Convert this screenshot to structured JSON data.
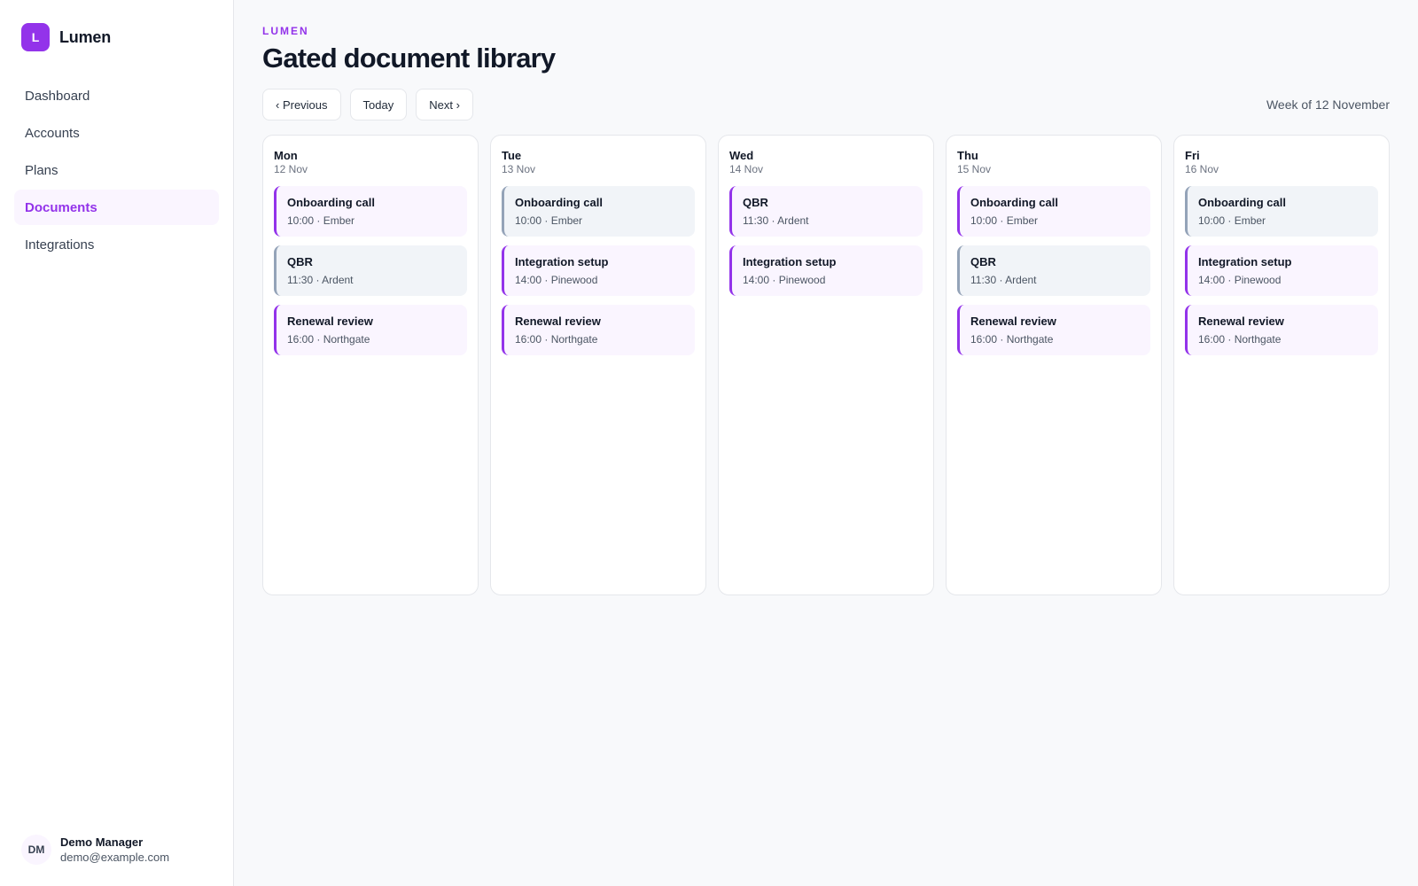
{
  "brand": {
    "logo_letter": "L",
    "name": "Lumen"
  },
  "nav": [
    {
      "label": "Dashboard",
      "active": false
    },
    {
      "label": "Accounts",
      "active": false
    },
    {
      "label": "Plans",
      "active": false
    },
    {
      "label": "Documents",
      "active": true
    },
    {
      "label": "Integrations",
      "active": false
    }
  ],
  "user": {
    "initials": "DM",
    "name": "Demo Manager",
    "email": "demo@example.com"
  },
  "header": {
    "eyebrow": "LUMEN",
    "title": "Gated document library"
  },
  "toolbar": {
    "previous_label": "‹ Previous",
    "today_label": "Today",
    "next_label": "Next ›",
    "week_label": "Week of 12 November"
  },
  "colors": {
    "accent": "#9333ea",
    "accent_bg": "#faf5ff",
    "muted": "#94a3b8",
    "muted_bg": "#f1f4f8"
  },
  "days": [
    {
      "name": "Mon",
      "date": "12 Nov",
      "events": [
        {
          "title": "Onboarding call",
          "meta": "10:00 · Ember",
          "style": "accent"
        },
        {
          "title": "QBR",
          "meta": "11:30 · Ardent",
          "style": "muted"
        },
        {
          "title": "Renewal review",
          "meta": "16:00 · Northgate",
          "style": "accent"
        }
      ]
    },
    {
      "name": "Tue",
      "date": "13 Nov",
      "events": [
        {
          "title": "Onboarding call",
          "meta": "10:00 · Ember",
          "style": "muted"
        },
        {
          "title": "Integration setup",
          "meta": "14:00 · Pinewood",
          "style": "accent"
        },
        {
          "title": "Renewal review",
          "meta": "16:00 · Northgate",
          "style": "accent"
        }
      ]
    },
    {
      "name": "Wed",
      "date": "14 Nov",
      "events": [
        {
          "title": "QBR",
          "meta": "11:30 · Ardent",
          "style": "accent"
        },
        {
          "title": "Integration setup",
          "meta": "14:00 · Pinewood",
          "style": "accent"
        }
      ]
    },
    {
      "name": "Thu",
      "date": "15 Nov",
      "events": [
        {
          "title": "Onboarding call",
          "meta": "10:00 · Ember",
          "style": "accent"
        },
        {
          "title": "QBR",
          "meta": "11:30 · Ardent",
          "style": "muted"
        },
        {
          "title": "Renewal review",
          "meta": "16:00 · Northgate",
          "style": "accent"
        }
      ]
    },
    {
      "name": "Fri",
      "date": "16 Nov",
      "events": [
        {
          "title": "Onboarding call",
          "meta": "10:00 · Ember",
          "style": "muted"
        },
        {
          "title": "Integration setup",
          "meta": "14:00 · Pinewood",
          "style": "accent"
        },
        {
          "title": "Renewal review",
          "meta": "16:00 · Northgate",
          "style": "accent"
        }
      ]
    }
  ]
}
